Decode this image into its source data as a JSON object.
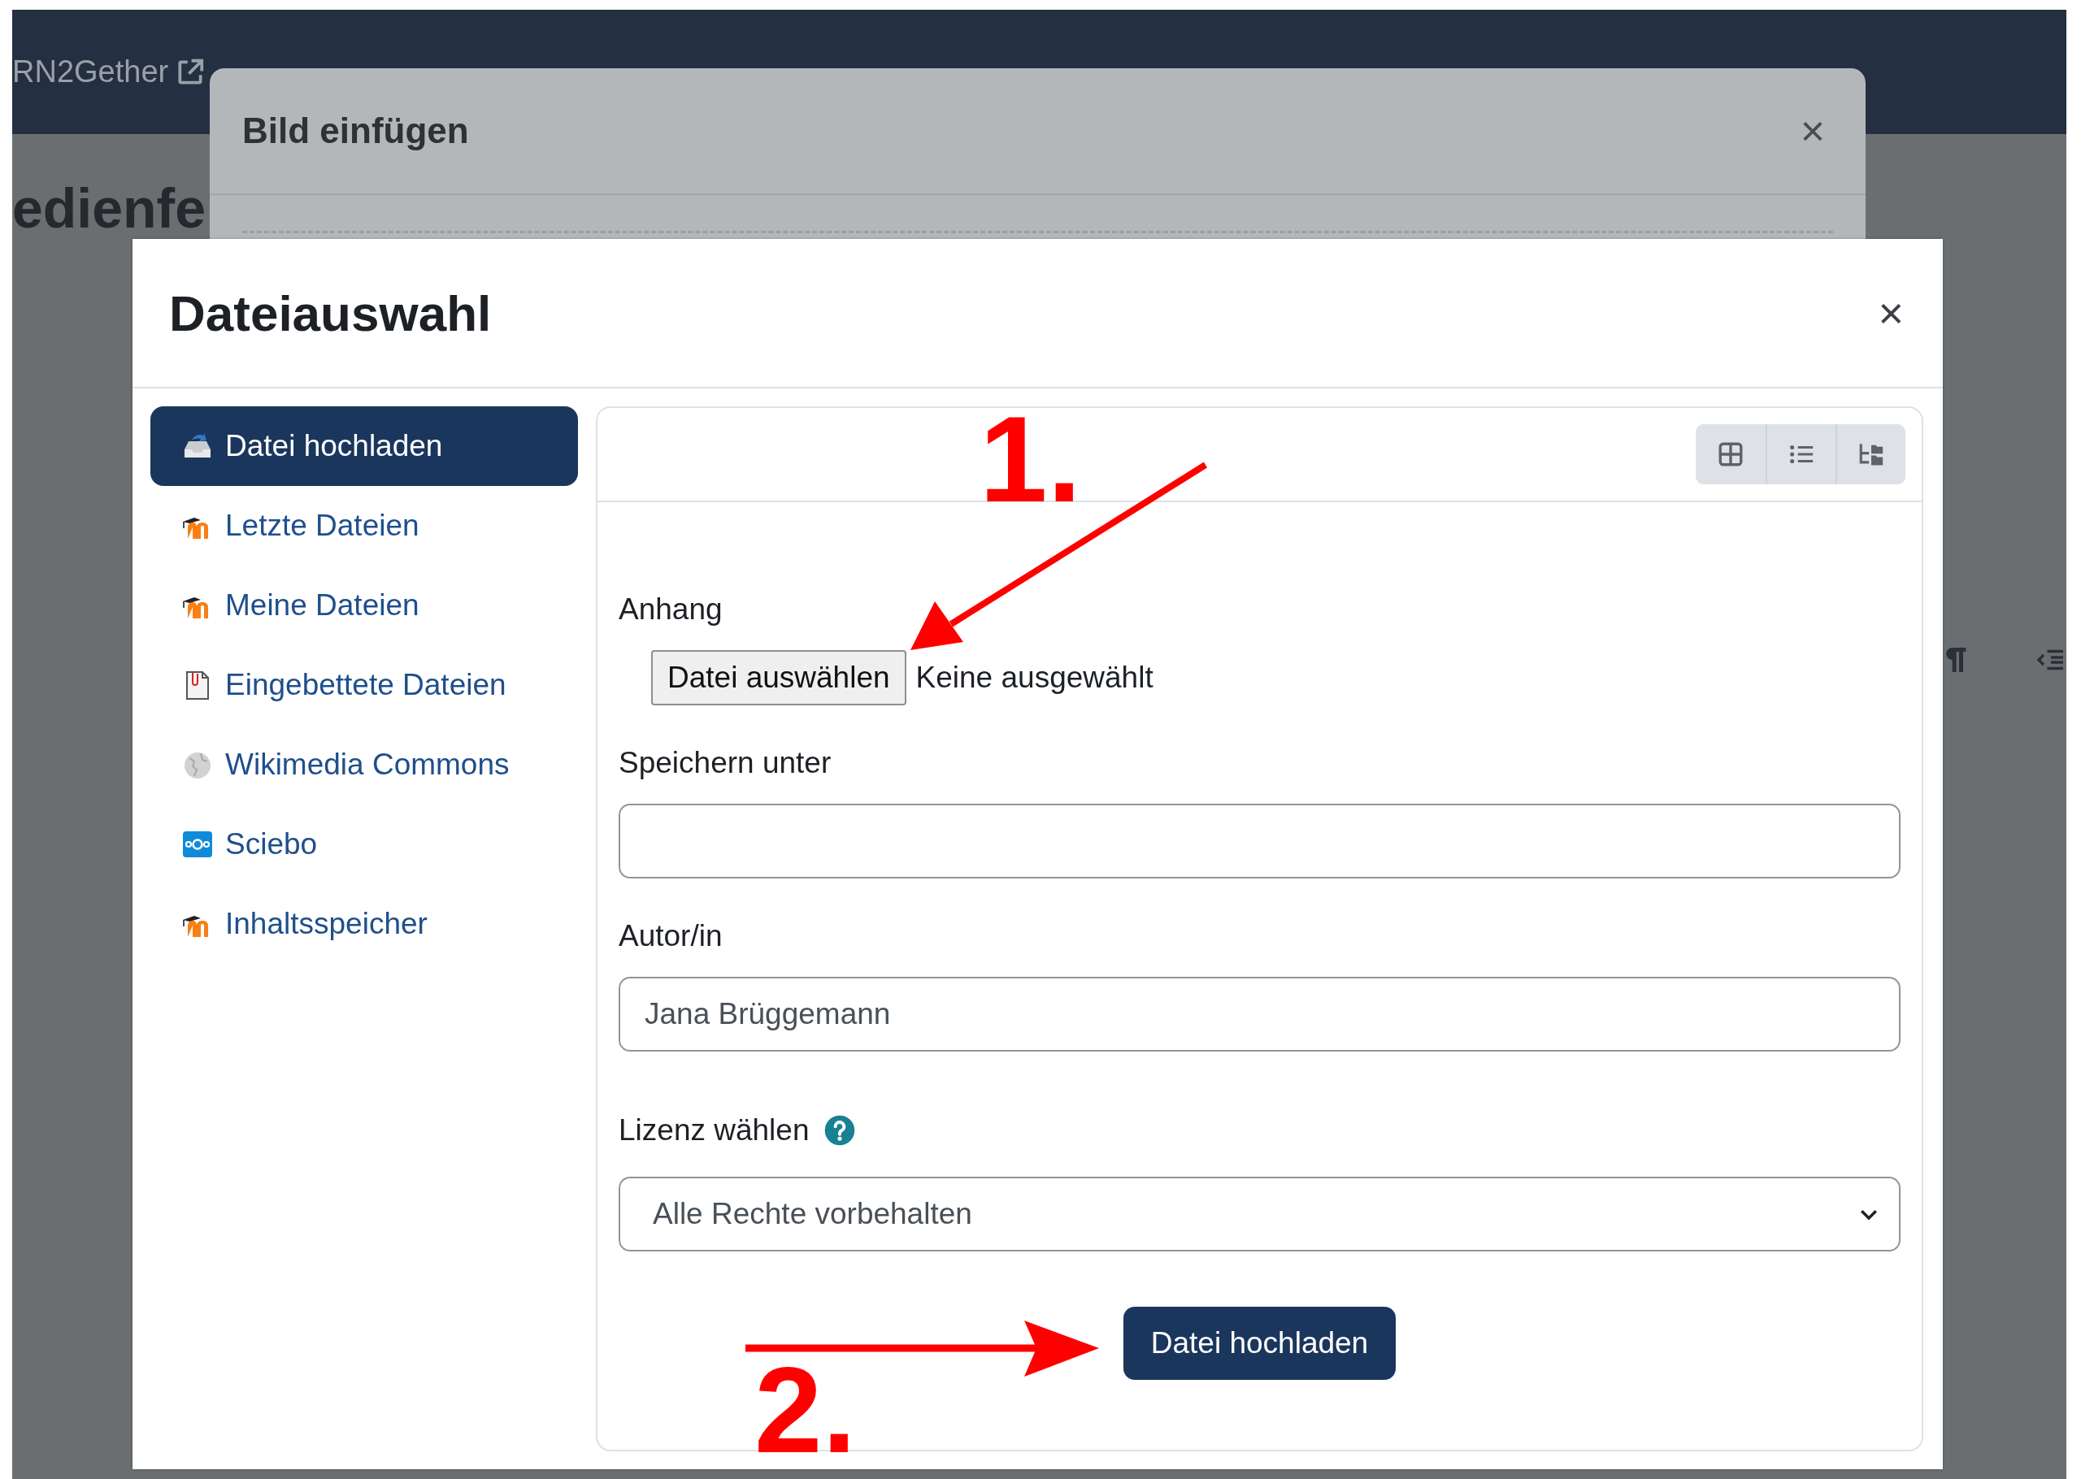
{
  "top_nav": {
    "links": [
      {
        "label": "RN2Gether"
      }
    ]
  },
  "page_heading": "edienfe",
  "image_dialog": {
    "title": "Bild einfügen",
    "close": "×"
  },
  "file_picker": {
    "title": "Dateiauswahl",
    "close": "×",
    "repositories": [
      {
        "label": "Datei hochladen",
        "kind": "upload",
        "selected": true
      },
      {
        "label": "Letzte Dateien",
        "kind": "moodle",
        "selected": false
      },
      {
        "label": "Meine Dateien",
        "kind": "moodle",
        "selected": false
      },
      {
        "label": "Eingebettete Dateien",
        "kind": "embedded",
        "selected": false
      },
      {
        "label": "Wikimedia Commons",
        "kind": "wikimedia",
        "selected": false
      },
      {
        "label": "Sciebo",
        "kind": "sciebo",
        "selected": false
      },
      {
        "label": "Inhaltsspeicher",
        "kind": "moodle",
        "selected": false
      }
    ],
    "view_buttons": [
      {
        "kind": "grid"
      },
      {
        "kind": "list"
      },
      {
        "kind": "tree"
      }
    ],
    "form": {
      "fields": [
        {
          "kind": "file",
          "label": "Anhang",
          "button": "Datei auswählen",
          "status": "Keine ausgewählt"
        },
        {
          "kind": "text",
          "label": "Speichern unter"
        },
        {
          "kind": "text",
          "label": "Autor/in",
          "value": "Jana Brüggemann"
        },
        {
          "kind": "select",
          "label": "Lizenz wählen",
          "help": true,
          "value": "Alle Rechte vorbehalten"
        }
      ],
      "submit": "Datei hochladen"
    }
  },
  "annotations": [
    {
      "text": "1."
    },
    {
      "text": "2."
    }
  ]
}
